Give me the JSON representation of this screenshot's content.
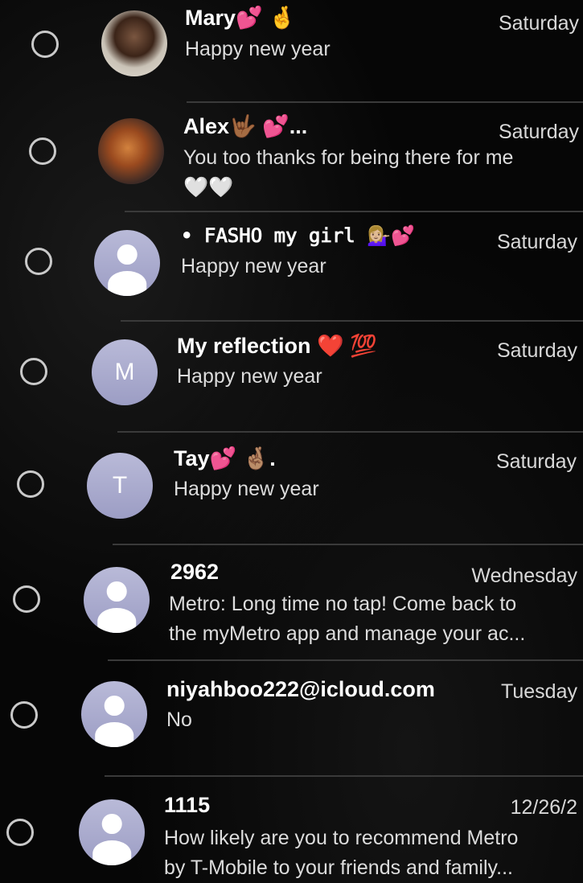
{
  "conversations": [
    {
      "name": "Mary💕 🤞",
      "date": "Saturday",
      "preview": "Happy new year",
      "avatar": "photo",
      "avatar_icon": "contact-photo"
    },
    {
      "name": "Alex🤟🏾 💕...",
      "date": "Saturday",
      "preview": "You too thanks for being there for me\n🤍🤍",
      "avatar": "photo",
      "avatar_icon": "contact-photo"
    },
    {
      "name": "• 𝙵𝙰𝚂𝙷𝙾 𝚖𝚢 𝚐𝚒𝚛𝚕 💁🏼‍♀️💕",
      "date": "Saturday",
      "preview": "Happy new year",
      "avatar": "person",
      "avatar_icon": "person-icon"
    },
    {
      "name": "My reflection ❤️ 💯",
      "date": "Saturday",
      "preview": "Happy new year",
      "avatar": "initial",
      "initial": "M"
    },
    {
      "name": "Tay💕 🤞🏽.",
      "date": "Saturday",
      "preview": "Happy new year",
      "avatar": "initial",
      "initial": "T"
    },
    {
      "name": "2962",
      "date": "Wednesday",
      "preview": "Metro: Long time no tap! Come back to\nthe myMetro app and manage your ac...",
      "avatar": "person",
      "avatar_icon": "person-icon"
    },
    {
      "name": "niyahboo222@icloud.com",
      "date": "Tuesday",
      "preview": "No",
      "avatar": "person",
      "avatar_icon": "person-icon"
    },
    {
      "name": "1115",
      "date": "12/26/2",
      "preview": "How likely are you to recommend Metro\nby T-Mobile to your friends and family...",
      "avatar": "person",
      "avatar_icon": "person-icon"
    }
  ],
  "colors": {
    "background": "#060606",
    "avatar_fill": "#a9aacd",
    "selector_ring": "#c9c9c9",
    "divider": "#3a3a3a"
  }
}
